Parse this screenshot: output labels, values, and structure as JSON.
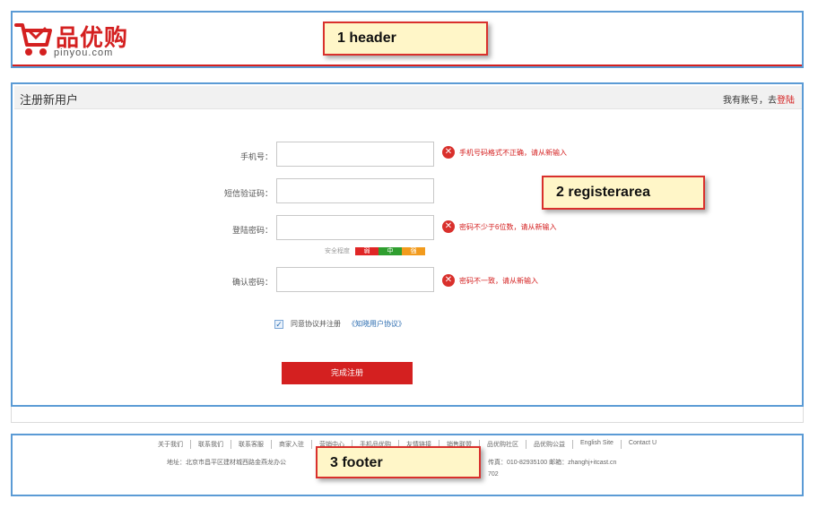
{
  "brand": {
    "name": "品优购",
    "domain": "pinyou.com",
    "color": "#d42020"
  },
  "callouts": {
    "header": "1  header",
    "register": "2  registerarea",
    "footer": "3 footer"
  },
  "register": {
    "title": "注册新用户",
    "login_prompt": "我有账号，去",
    "login_link": "登陆",
    "fields": [
      {
        "label": "手机号：",
        "value": "",
        "error": "手机号码格式不正确，请从新输入",
        "icon": "error-x-icon"
      },
      {
        "label": "短信验证码：",
        "value": "",
        "error": "",
        "icon": ""
      },
      {
        "label": "登陆密码：",
        "value": "",
        "error": "密码不少于6位数，请从新输入",
        "icon": "error-x-icon"
      },
      {
        "label": "确认密码：",
        "value": "",
        "error": "密码不一致，请从新输入",
        "icon": "error-x-icon"
      }
    ],
    "strength": {
      "label": "安全程度",
      "levels": [
        {
          "text": "弱",
          "color": "#e02626"
        },
        {
          "text": "中",
          "color": "#2f9e2f"
        },
        {
          "text": "强",
          "color": "#f29b1d"
        }
      ]
    },
    "agreement": {
      "checked": true,
      "text": "同意协议并注册",
      "link": "《知晓用户协议》"
    },
    "submit_label": "完成注册"
  },
  "footer": {
    "links": [
      "关于我们",
      "联系我们",
      "联系客服",
      "商家入驻",
      "营销中心",
      "手机品优购",
      "友情链接",
      "销售联盟",
      "品优购社区",
      "品优购公益",
      "English Site",
      "Contact U"
    ],
    "address": "地址：北京市昌平区建材城西路金燕龙办公",
    "contact": "传真：010-82935100  邮箱：zhanghj+itcast.cn",
    "icp": "702"
  }
}
